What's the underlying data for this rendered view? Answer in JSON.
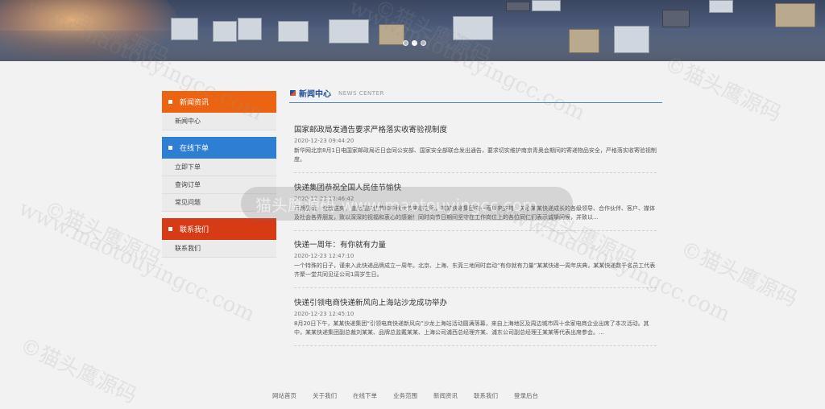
{
  "banner": {
    "alt": "airport cargo banner",
    "slides": [
      "slide-1",
      "slide-2",
      "slide-3"
    ],
    "active_slide": 2
  },
  "sidebar": {
    "sections": [
      {
        "title": "新闻资讯",
        "color": "#ec6412",
        "items": [
          "新闻中心"
        ]
      },
      {
        "title": "在线下单",
        "color": "#2e7ed4",
        "items": [
          "立即下单",
          "查询订单",
          "常见问题"
        ]
      },
      {
        "title": "联系我们",
        "color": "#d63b16",
        "items": [
          "联系我们"
        ]
      }
    ]
  },
  "main": {
    "title": "新闻中心",
    "subtitle": "NEWS CENTER",
    "news": [
      {
        "headline": "国家邮政局发通告要求严格落实收寄验视制度",
        "date": "2020-12-23 09:44:20",
        "summary": "新华网北京8月1日电国家邮政局近日会同公安部、国家安全部联合发出通告，要求切实维护南京青奥会期间的寄递物品安全，严格落实收寄验视制度。"
      },
      {
        "headline": "快递集团恭祝全国人民佳节愉快",
        "date": "2020-12-23 12:46:42",
        "summary": "月朗星疏，金秋送爽。值此国庆佳节和中秋佳节来临之际，某某快递集团向一直以来支持、关心某某快递成长的各级领导、合作伙伴、客户、媒体及社会各界朋友，致以深深的祝福和衷心的感谢！同时向节日期间坚守在工作岗位上的各位同仁们表示诚挚问候，并致以..."
      },
      {
        "headline": "快递一周年：有你就有力量",
        "date": "2020-12-23 12:47:10",
        "summary": "一个特殊的日子，谨来入此快递品牌成立一周年。北京、上海、东莞三地同时启动“有你就有力量”某某快递一周年庆典，某某快递数千名员工代表齐聚一堂共同见证公司1周岁生日。"
      },
      {
        "headline": "快递引领电商快递新风向上海站沙龙成功举办",
        "date": "2020-12-23 12:45:10",
        "summary": "8月20日下午，某某快递集团“引领电商快递新风向”沙龙上海站活动圆满落幕，来自上海地区及周边城市四十余家电商企业出席了本次活动。其中，某某快递集团副总裁刘某某、品牌总监戴某某、上海公司浦西总经理齐某、浦东公司副总经理王某某等代表出席参会。..."
      }
    ]
  },
  "footer": {
    "links": [
      "网站首页",
      "关于我们",
      "在线下单",
      "业务范围",
      "新闻资讯",
      "联系我们",
      "登录后台"
    ]
  },
  "watermark": {
    "text_cn": "©猫头鹰源码",
    "text_url": "www.maotouyingcc.com",
    "center": "猫头鹰源码  www.maotouyingcc.com"
  }
}
